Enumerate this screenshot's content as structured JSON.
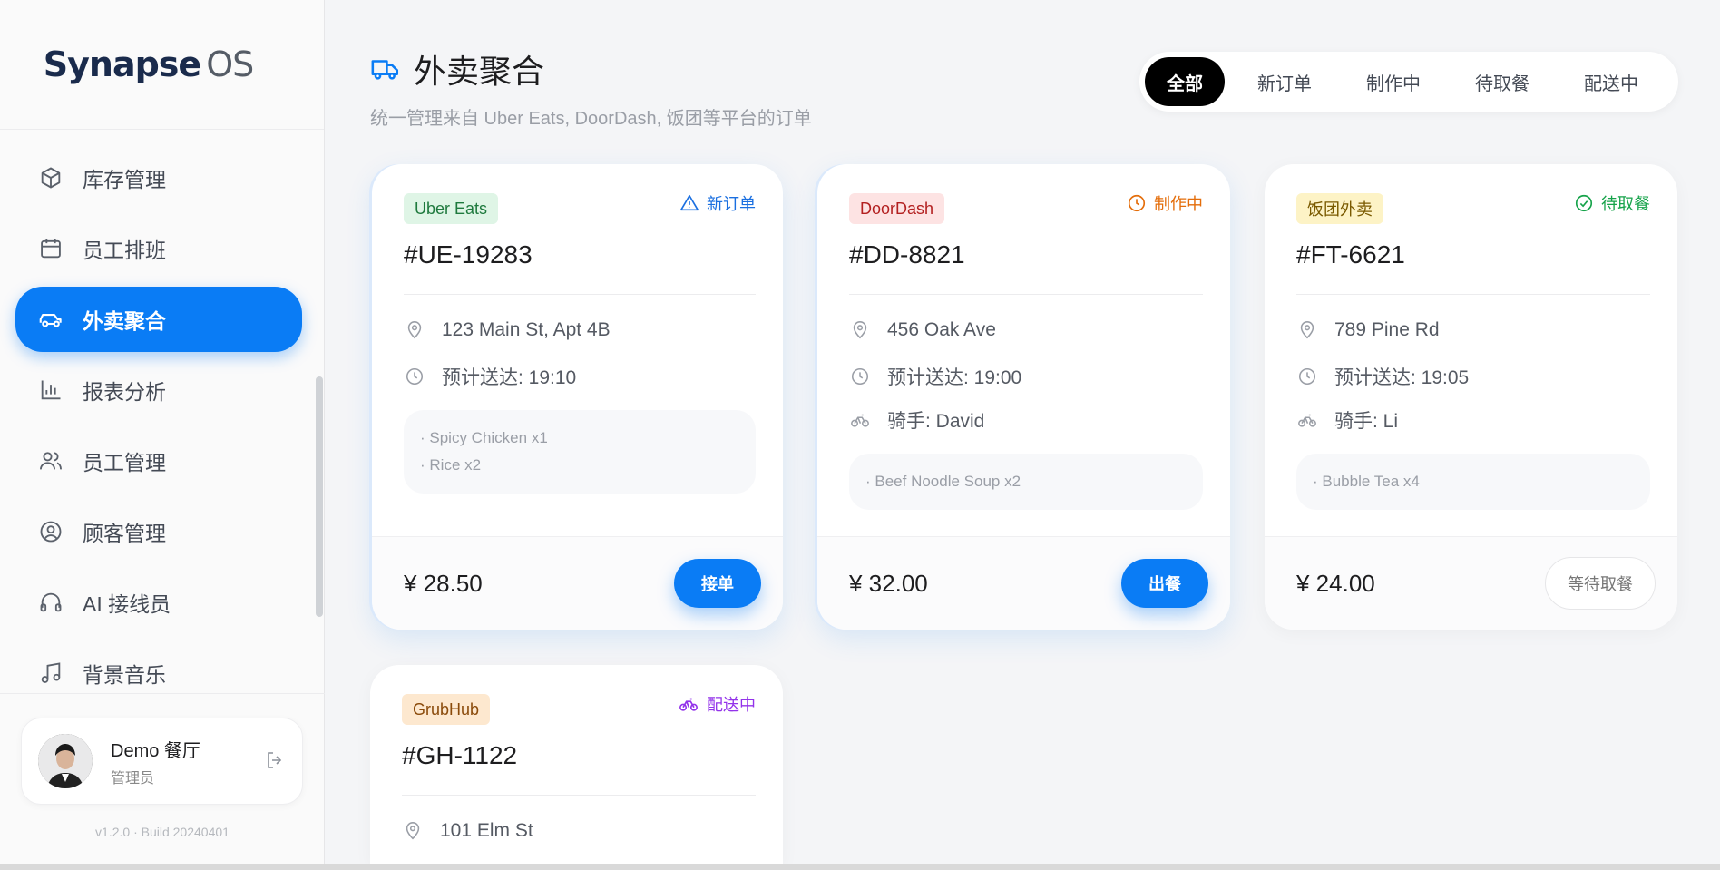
{
  "brand": {
    "name": "Synapse",
    "suffix": "OS"
  },
  "sidebar": {
    "items": [
      {
        "label": "库存管理",
        "icon": "box-icon"
      },
      {
        "label": "员工排班",
        "icon": "calendar-icon"
      },
      {
        "label": "外卖聚合",
        "icon": "car-icon",
        "active": true
      },
      {
        "label": "报表分析",
        "icon": "bar-chart-icon"
      },
      {
        "label": "员工管理",
        "icon": "users-icon"
      },
      {
        "label": "顾客管理",
        "icon": "user-circle-icon"
      },
      {
        "label": "AI 接线员",
        "icon": "headphones-icon"
      },
      {
        "label": "背景音乐",
        "icon": "music-icon"
      }
    ],
    "user": {
      "name": "Demo 餐厅",
      "role": "管理员"
    },
    "version": "v1.2.0 · Build 20240401"
  },
  "header": {
    "title": "外卖聚合",
    "subtitle": "统一管理来自 Uber Eats, DoorDash, 饭团等平台的订单"
  },
  "tabs": [
    {
      "label": "全部",
      "active": true
    },
    {
      "label": "新订单"
    },
    {
      "label": "制作中"
    },
    {
      "label": "待取餐"
    },
    {
      "label": "配送中"
    }
  ],
  "orders": [
    {
      "platform": "Uber Eats",
      "platform_bg": "#dff5e6",
      "platform_color": "#1f7a3e",
      "status": "新订单",
      "status_color": "#1a6fe0",
      "status_icon": "alert-triangle-icon",
      "id": "#UE-19283",
      "address": "123 Main St, Apt 4B",
      "eta": "预计送达: 19:10",
      "items": [
        "· Spicy Chicken x1",
        "· Rice x2"
      ],
      "price": "¥ 28.50",
      "action": "接单"
    },
    {
      "platform": "DoorDash",
      "platform_bg": "#fde3e3",
      "platform_color": "#b32020",
      "status": "制作中",
      "status_color": "#e46d0a",
      "status_icon": "clock-icon",
      "id": "#DD-8821",
      "address": "456 Oak Ave",
      "eta": "预计送达: 19:00",
      "rider": "骑手: David",
      "items": [
        "· Beef Noodle Soup x2"
      ],
      "price": "¥ 32.00",
      "action": "出餐"
    },
    {
      "platform": "饭团外卖",
      "platform_bg": "#fdf3c6",
      "platform_color": "#7a5a00",
      "status": "待取餐",
      "status_color": "#16a34a",
      "status_icon": "check-circle-icon",
      "id": "#FT-6621",
      "address": "789 Pine Rd",
      "eta": "预计送达: 19:05",
      "rider": "骑手: Li",
      "items": [
        "· Bubble Tea x4"
      ],
      "price": "¥ 24.00",
      "action": "等待取餐"
    },
    {
      "platform": "GrubHub",
      "platform_bg": "#fde8cf",
      "platform_color": "#8a4a0a",
      "status": "配送中",
      "status_color": "#9333ea",
      "status_icon": "bike-icon",
      "id": "#GH-1122",
      "address": "101 Elm St"
    }
  ]
}
